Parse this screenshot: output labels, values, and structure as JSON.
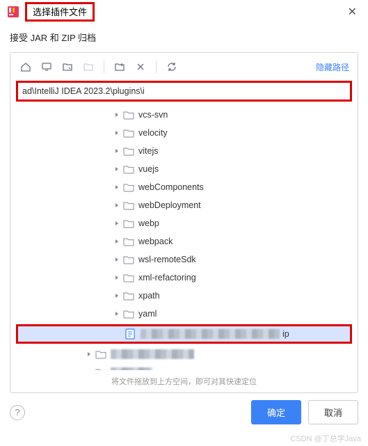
{
  "titlebar": {
    "title": "选择插件文件"
  },
  "subtitle": "接受 JAR 和 ZIP 归档",
  "toolbar": {
    "hide_path": "隐藏路径"
  },
  "path_input": {
    "value": "ad\\IntelliJ IDEA 2023.2\\plugins\\i"
  },
  "tree": {
    "folders": [
      "vcs-svn",
      "velocity",
      "vitejs",
      "vuejs",
      "webComponents",
      "webDeployment",
      "webp",
      "webpack",
      "wsl-remoteSdk",
      "xml-refactoring",
      "xpath",
      "yaml"
    ],
    "selected_file_suffix": "ip"
  },
  "hint": "将文件拖放到上方空间，即可对其快速定位",
  "footer": {
    "ok": "确定",
    "cancel": "取消"
  },
  "watermark": "CSDN @丁总学Java"
}
